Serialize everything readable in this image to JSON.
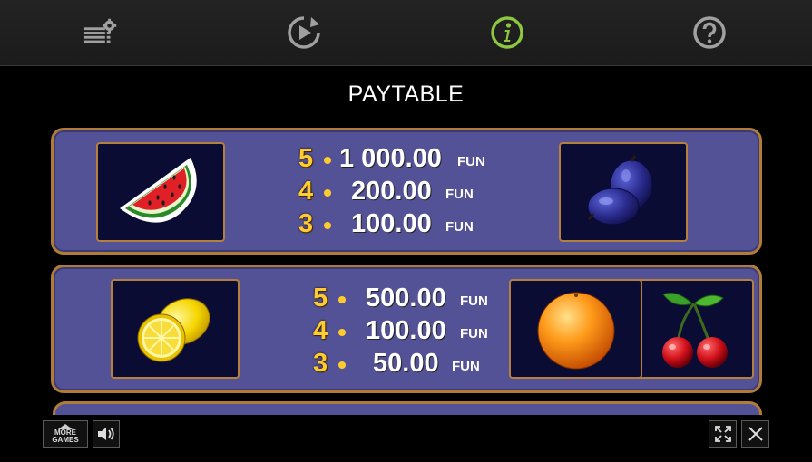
{
  "toolbar": {
    "icons": [
      "bet-settings-icon",
      "autoplay-icon",
      "info-icon",
      "help-icon"
    ],
    "active_color": "#8dc63f",
    "icon_color": "#a0a0a0"
  },
  "title": "PAYTABLE",
  "panels": [
    {
      "symbols": [
        "watermelon",
        "plum"
      ],
      "rows": [
        {
          "count": "5",
          "amount": "1 000.00",
          "currency": "FUN"
        },
        {
          "count": "4",
          "amount": "200.00",
          "currency": "FUN"
        },
        {
          "count": "3",
          "amount": "100.00",
          "currency": "FUN"
        }
      ]
    },
    {
      "symbols": [
        "lemon",
        "orange",
        "cherries"
      ],
      "rows": [
        {
          "count": "5",
          "amount": "500.00",
          "currency": "FUN"
        },
        {
          "count": "4",
          "amount": "100.00",
          "currency": "FUN"
        },
        {
          "count": "3",
          "amount": "50.00",
          "currency": "FUN"
        }
      ]
    }
  ],
  "bottom": {
    "more_games_line1": "MORE",
    "more_games_line2": "GAMES"
  }
}
